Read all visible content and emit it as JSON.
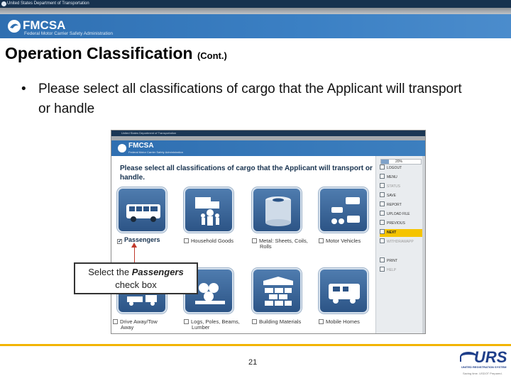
{
  "header": {
    "dot_text": "United States Department of Transportation",
    "agency": "FMCSA",
    "agency_sub": "Federal Motor Carrier Safety Administration"
  },
  "slide": {
    "title": "Operation Classification",
    "title_suffix": "(Cont.)",
    "bullet": "Please select all classifications of cargo that the Applicant will transport or handle",
    "page_number": "21"
  },
  "screenshot": {
    "dot_text": "United States Department of Transportation",
    "agency": "FMCSA",
    "agency_sub": "Federal Motor Carrier Safety Administration",
    "question": "Please select all classifications of cargo that the Applicant will transport or handle.",
    "progress_label": "20%",
    "progress_value": 0.2,
    "cargo_options": [
      {
        "label": "Passengers",
        "checked": true
      },
      {
        "label": "Household Goods",
        "checked": false
      },
      {
        "label": "Metal: Sheets, Coils,",
        "label2": "Rolls",
        "checked": false
      },
      {
        "label": "Motor Vehicles",
        "checked": false
      },
      {
        "label": "Drive Away/Tow",
        "label2": "Away",
        "checked": false
      },
      {
        "label": "Logs, Poles, Beams,",
        "label2": "Lumber",
        "checked": false
      },
      {
        "label": "Building Materials",
        "checked": false
      },
      {
        "label": "Mobile Homes",
        "checked": false
      }
    ],
    "nav": [
      {
        "label": "LOGOUT"
      },
      {
        "label": "MENU"
      },
      {
        "label": "STATUS"
      },
      {
        "label": "SAVE"
      },
      {
        "label": "REPORT"
      },
      {
        "label": "UPLOAD FILE"
      },
      {
        "label": "PREVIOUS"
      },
      {
        "label": "NEXT"
      },
      {
        "label": "WITHDRAWAPP"
      },
      {
        "label": "PRINT"
      },
      {
        "label": "HELP"
      }
    ]
  },
  "callout": {
    "pre": "Select the",
    "emph": "Passengers",
    "post": "check box"
  },
  "footer": {
    "logo": "URS",
    "logo_sub": "UNITED REGISTRATION SYSTEM",
    "logo_sub2": "Saving time. USDOT Prepared."
  },
  "colors": {
    "fmcsa_blue": "#3b80c4",
    "navy": "#17324f",
    "accent_yellow": "#f2b400",
    "nav_active": "#f5c400",
    "callout_arrow": "#c0392b",
    "urs_blue": "#1f3f8a"
  }
}
